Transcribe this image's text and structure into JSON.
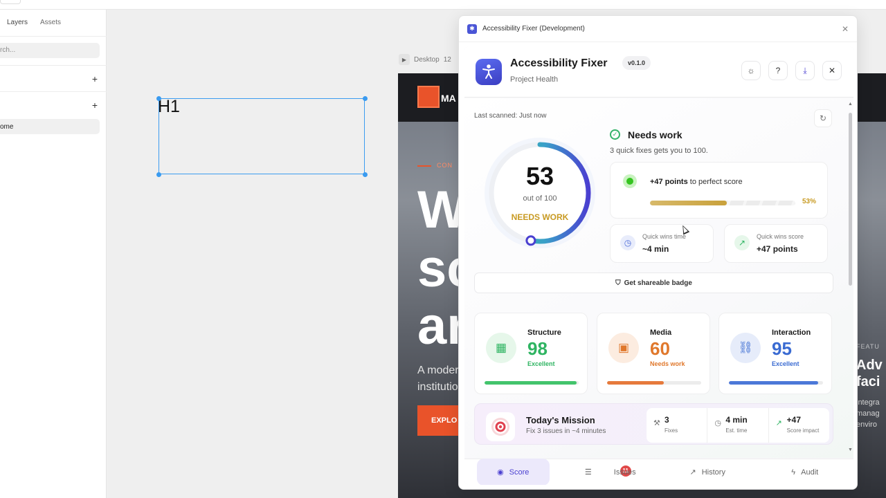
{
  "left_panel": {
    "tabs": [
      "Layers",
      "Assets"
    ],
    "search_placeholder": "rch...",
    "page_item": "ome"
  },
  "canvas": {
    "selected_text": "H1",
    "frame_label": "Desktop",
    "frame_size": "12"
  },
  "site": {
    "logo_text": "MA",
    "kicker": "CON",
    "headline_lines": [
      "W",
      "sc",
      "ar"
    ],
    "subtitle_lines": [
      "A moder",
      "institutio"
    ],
    "cta": "EXPLO",
    "feature_kicker": "FEATU",
    "feature_lines": [
      "Adv",
      "faci"
    ],
    "feature_text": [
      "integra",
      "manag",
      "enviro"
    ]
  },
  "plugin": {
    "window_title": "Accessibility Fixer (Development)",
    "app_name": "Accessibility Fixer",
    "version": "v0.1.0",
    "subtitle": "Project Health",
    "last_scanned": "Last scanned: Just now",
    "score": {
      "value": "53",
      "out_of": "out of 100",
      "status": "NEEDS WORK",
      "fraction": 0.53
    },
    "summary_title": "Needs work",
    "summary_sub": "3 quick fixes gets you to 100.",
    "points_bold": "+47 points",
    "points_rest": " to perfect score",
    "points_pct": "53%",
    "points_fraction": 0.53,
    "quick_time_label": "Quick wins time",
    "quick_time_value": "~4 min",
    "quick_score_label": "Quick wins score",
    "quick_score_value": "+47 points",
    "badge_button": "Get shareable badge",
    "categories": [
      {
        "name": "Structure",
        "score": "98",
        "status": "Excellent",
        "fraction": 0.98,
        "color": "#2fb462",
        "bar_color": "#43c46c",
        "icon_bg": "#e6f7ea"
      },
      {
        "name": "Media",
        "score": "60",
        "status": "Needs work",
        "fraction": 0.6,
        "color": "#e0782c",
        "bar_color": "#e67a3c",
        "icon_bg": "#fcece0"
      },
      {
        "name": "Interaction",
        "score": "95",
        "status": "Excellent",
        "fraction": 0.95,
        "color": "#3a6bd2",
        "bar_color": "#4c78d8",
        "icon_bg": "#e6ecfa"
      }
    ],
    "mission": {
      "title": "Today's Mission",
      "sub": "Fix 3 issues in ~4 minutes",
      "stats": [
        {
          "value": "3",
          "label": "Fixes"
        },
        {
          "value": "4 min",
          "label": "Est. time"
        },
        {
          "value": "+47",
          "label": "Score impact"
        }
      ]
    },
    "nav": [
      {
        "label": "Score"
      },
      {
        "label": "Issues",
        "badge": "11"
      },
      {
        "label": "History"
      },
      {
        "label": "Audit"
      }
    ]
  }
}
